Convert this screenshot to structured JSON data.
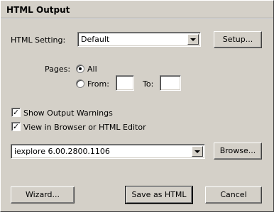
{
  "dialog": {
    "title": "HTML Output"
  },
  "html_setting": {
    "label": "HTML Setting:",
    "value": "Default",
    "setup_label": "Setup..."
  },
  "pages": {
    "label": "Pages:",
    "all_label": "All",
    "from_label": "From:",
    "to_label": "To:",
    "from_value": "",
    "to_value": "",
    "selected": "All"
  },
  "options": {
    "show_warnings_label": "Show Output Warnings",
    "show_warnings_checked": true,
    "view_in_browser_label": "View in Browser or HTML Editor",
    "view_in_browser_checked": true
  },
  "browser": {
    "value": "iexplore 6.00.2800.1106",
    "browse_label": "Browse..."
  },
  "footer": {
    "wizard_label": "Wizard...",
    "save_label": "Save as HTML",
    "cancel_label": "Cancel"
  },
  "icons": {
    "dropdown": "chevron-down-icon",
    "check": "check-icon"
  }
}
